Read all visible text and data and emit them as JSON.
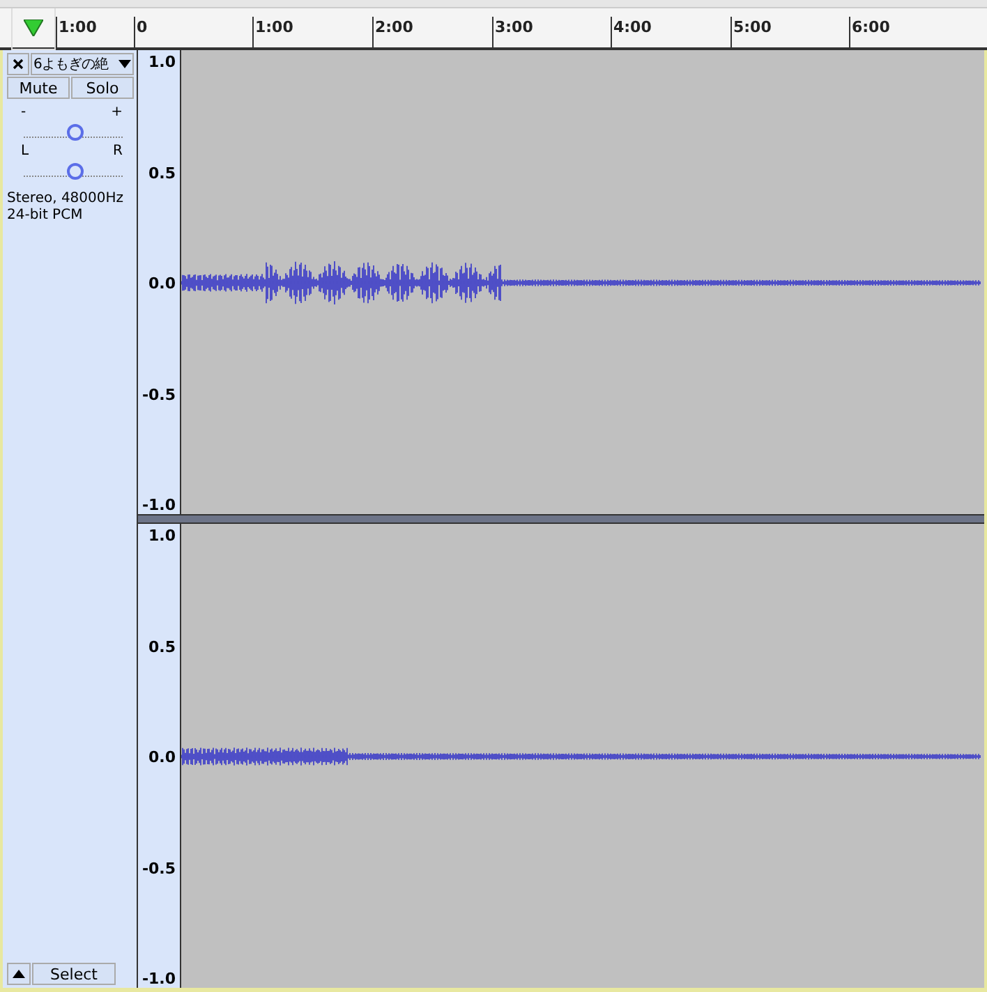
{
  "ruler": {
    "labels": [
      "1:00",
      "0",
      "1:00",
      "2:00",
      "3:00",
      "4:00",
      "5:00",
      "6:00"
    ]
  },
  "track": {
    "name": "6よもぎの絶",
    "mute": {
      "label": "Mute",
      "on": false
    },
    "solo": {
      "label": "Solo",
      "on": false
    },
    "gain": {
      "min_label": "-",
      "max_label": "+",
      "level": 0.5
    },
    "pan": {
      "min_label": "L",
      "max_label": "R",
      "level": 0.5
    },
    "info": [
      "Stereo, 48000Hz",
      "24-bit PCM"
    ],
    "select_label": "Select",
    "channels": [
      {
        "scale": [
          "1.0",
          "0.5",
          "0.0",
          "-0.5",
          "-1.0"
        ]
      },
      {
        "scale": [
          "1.0",
          "0.5",
          "0.0",
          "-0.5",
          "-1.0"
        ]
      }
    ]
  }
}
